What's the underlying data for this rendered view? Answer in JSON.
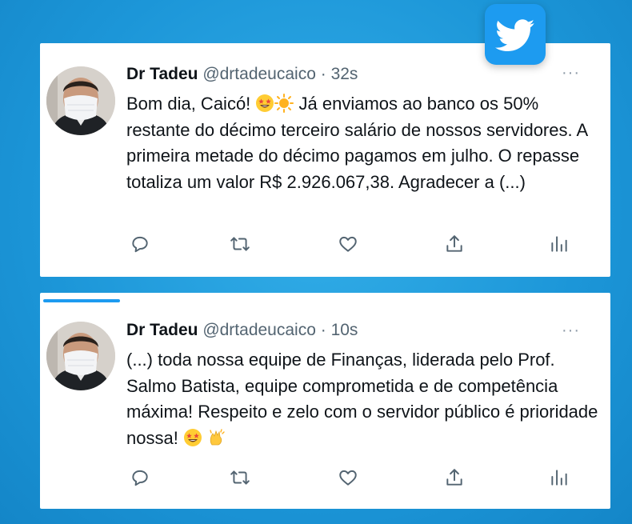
{
  "tweets": [
    {
      "name": "Dr Tadeu",
      "handle": "@drtadeucaico",
      "separator": "·",
      "time": "32s",
      "more": "···",
      "text_parts": [
        "Bom dia, Caicó! ",
        " Já enviamos ao banco os 50% restante do décimo terceiro salário de nossos servidores. A primeira metade do décimo pagamos em julho. O repasse totaliza um valor R$ 2.926.067,38. Agradecer a (...)"
      ],
      "emojis": [
        "star-struck-emoji",
        "sun-emoji"
      ]
    },
    {
      "name": "Dr Tadeu",
      "handle": "@drtadeucaico",
      "separator": "·",
      "time": "10s",
      "more": "···",
      "text_parts": [
        "(...) toda nossa equipe de Finanças, liderada pelo Prof. Salmo Batista, equipe comprometida e de competência máxima! Respeito e zelo com o servidor público é prioridade nossa! "
      ],
      "emojis": [
        "star-struck-emoji",
        "clapping-hands-emoji"
      ]
    }
  ],
  "actions": [
    "reply-icon",
    "retweet-icon",
    "like-icon",
    "share-icon",
    "analytics-icon"
  ],
  "colors": {
    "background": "#1c96d8",
    "twitter_blue": "#1d9bf0",
    "text": "#0f1419",
    "secondary_text": "#536471",
    "icon": "#536471"
  }
}
